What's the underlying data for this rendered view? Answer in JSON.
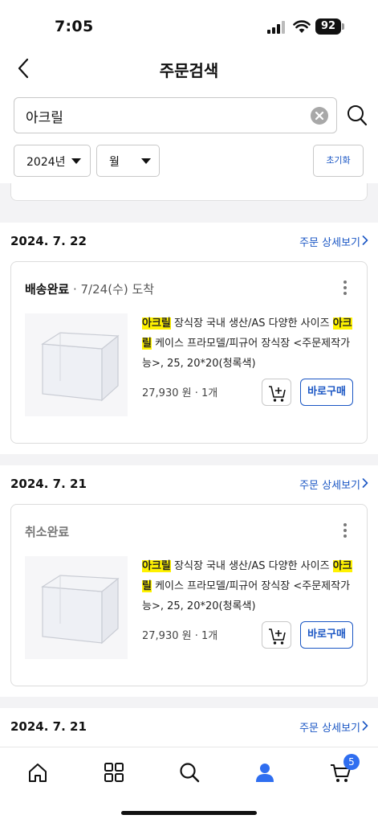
{
  "status_bar": {
    "time": "7:05",
    "battery": "92"
  },
  "header": {
    "title": "주문검색"
  },
  "search": {
    "value": "아크릴",
    "placeholder": ""
  },
  "filters": {
    "year": "2024년",
    "month": "월",
    "reset_label": "초기화"
  },
  "orders": [
    {
      "date": "2024. 7. 22",
      "detail_link": "주문 상세보기",
      "status": "배송완료",
      "arrival": " · 7/24(수) 도착",
      "title_highlight_1": "아크릴",
      "title_part_1": " 장식장 국내 생산/AS 다양한 사이즈 ",
      "title_highlight_2": "아크릴",
      "title_part_2": " 케이스 프라모델/피규어 장식장 <주문제작가능>, 25, 20*20(청록색)",
      "price_qty": "27,930 원 · 1개",
      "buy_label": "바로구매"
    },
    {
      "date": "2024. 7. 21",
      "detail_link": "주문 상세보기",
      "status": "취소완료",
      "arrival": "",
      "title_highlight_1": "아크릴",
      "title_part_1": " 장식장 국내 생산/AS 다양한 사이즈 ",
      "title_highlight_2": "아크릴",
      "title_part_2": " 케이스 프라모델/피규어 장식장 <주문제작가능>, 25, 20*20(청록색)",
      "price_qty": "27,930 원 · 1개",
      "buy_label": "바로구매"
    },
    {
      "date": "2024. 7. 21",
      "detail_link": "주문 상세보기"
    }
  ],
  "bottom_nav": {
    "items": [
      "home-icon",
      "category-grid-icon",
      "search-icon",
      "my-profile-icon",
      "cart-icon"
    ],
    "cart_badge": "5",
    "active": "my-profile-icon"
  },
  "colors": {
    "accent": "#1a56c4",
    "highlight": "#fff200",
    "badge": "#2f6ef0"
  }
}
